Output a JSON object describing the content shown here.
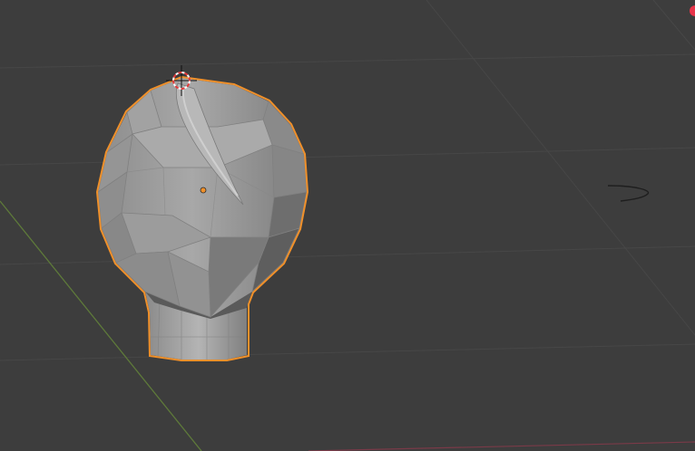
{
  "viewport": {
    "background_color": "#3d3d3d",
    "grid_color": "#4a4a4a",
    "x_axis_color": "#8b3a4a",
    "y_axis_color": "#6a8a3a"
  },
  "object": {
    "type": "head-mesh",
    "selected": true,
    "selection_outline_color": "#f0902a",
    "base_color": "#9a9a9a"
  },
  "icons": {
    "cursor": "3d-cursor-icon",
    "origin": "object-origin-icon",
    "camera_arc": "camera-arc-icon",
    "corner_indicator": "viewport-corner-dot-icon"
  }
}
